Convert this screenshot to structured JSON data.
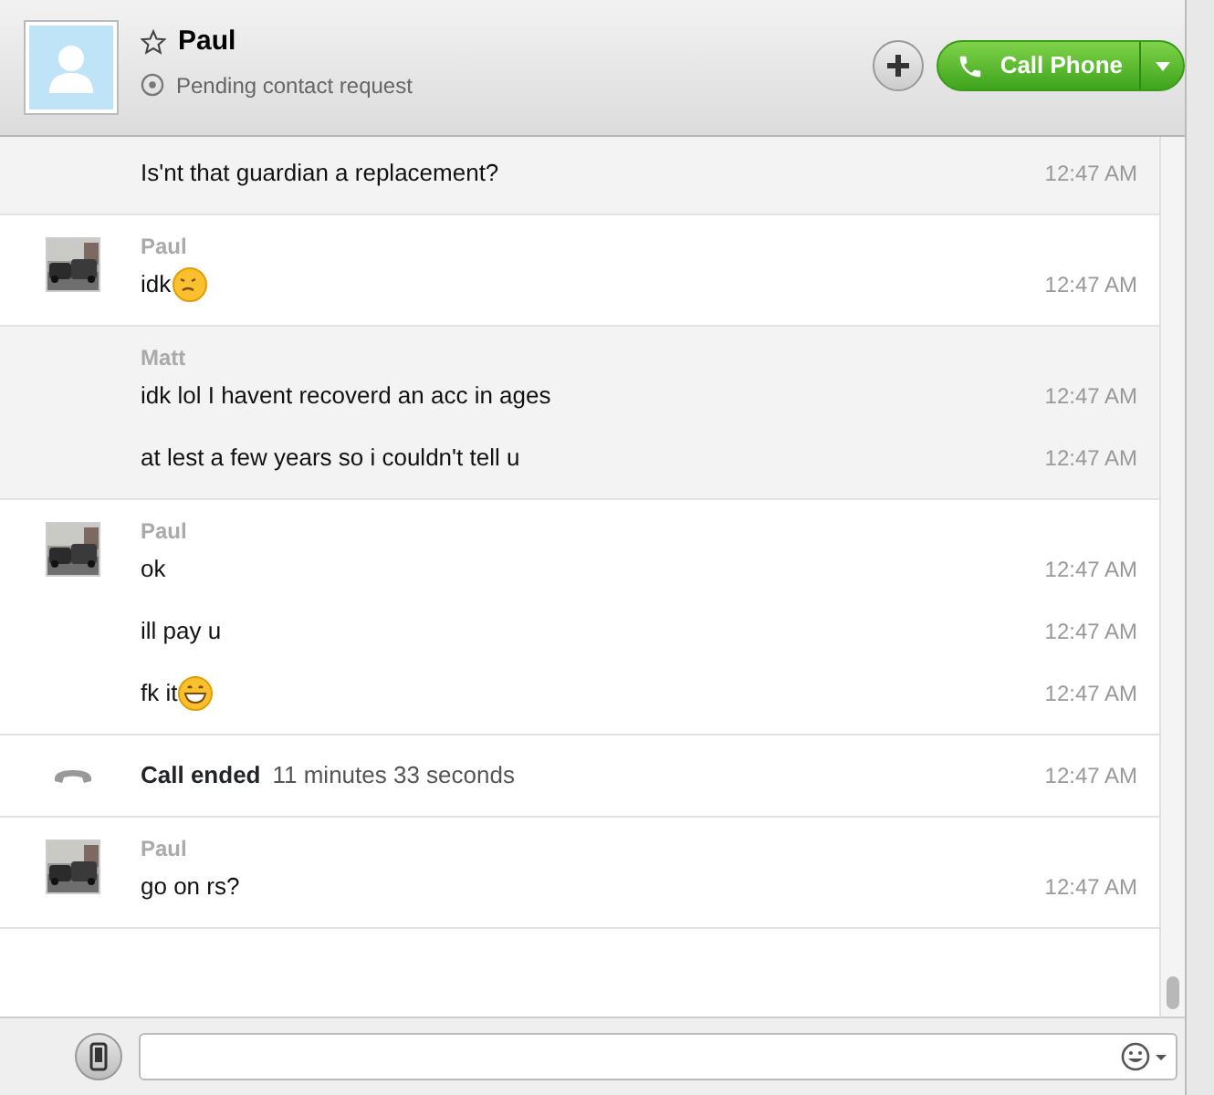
{
  "header": {
    "contact_name": "Paul",
    "favorite": false,
    "status": "Pending contact request",
    "call_button": "Call Phone"
  },
  "timeline": [
    {
      "kind": "sent",
      "messages": [
        {
          "text": "Is'nt that guardian a replacement?",
          "time": "12:47 AM"
        }
      ]
    },
    {
      "kind": "received",
      "sender": "Paul",
      "messages": [
        {
          "kind": "worried",
          "text": "idk",
          "time": "12:47 AM"
        }
      ]
    },
    {
      "kind": "sent",
      "sender": "Matt",
      "messages": [
        {
          "text": "idk lol I havent recoverd an acc in ages",
          "time": "12:47 AM"
        },
        {
          "text": "at lest a few years so i couldn't tell u",
          "time": "12:47 AM"
        }
      ]
    },
    {
      "kind": "received",
      "sender": "Paul",
      "messages": [
        {
          "text": "ok",
          "time": "12:47 AM"
        },
        {
          "text": "ill pay u",
          "time": "12:47 AM"
        },
        {
          "kind": "grin",
          "text": "fk it",
          "time": "12:47 AM"
        }
      ]
    },
    {
      "kind": "call",
      "title": "Call ended",
      "detail": "11 minutes 33 seconds",
      "time": "12:47 AM"
    },
    {
      "kind": "received",
      "sender": "Paul",
      "messages": [
        {
          "text": "go on rs?",
          "time": "12:47 AM"
        }
      ]
    }
  ]
}
